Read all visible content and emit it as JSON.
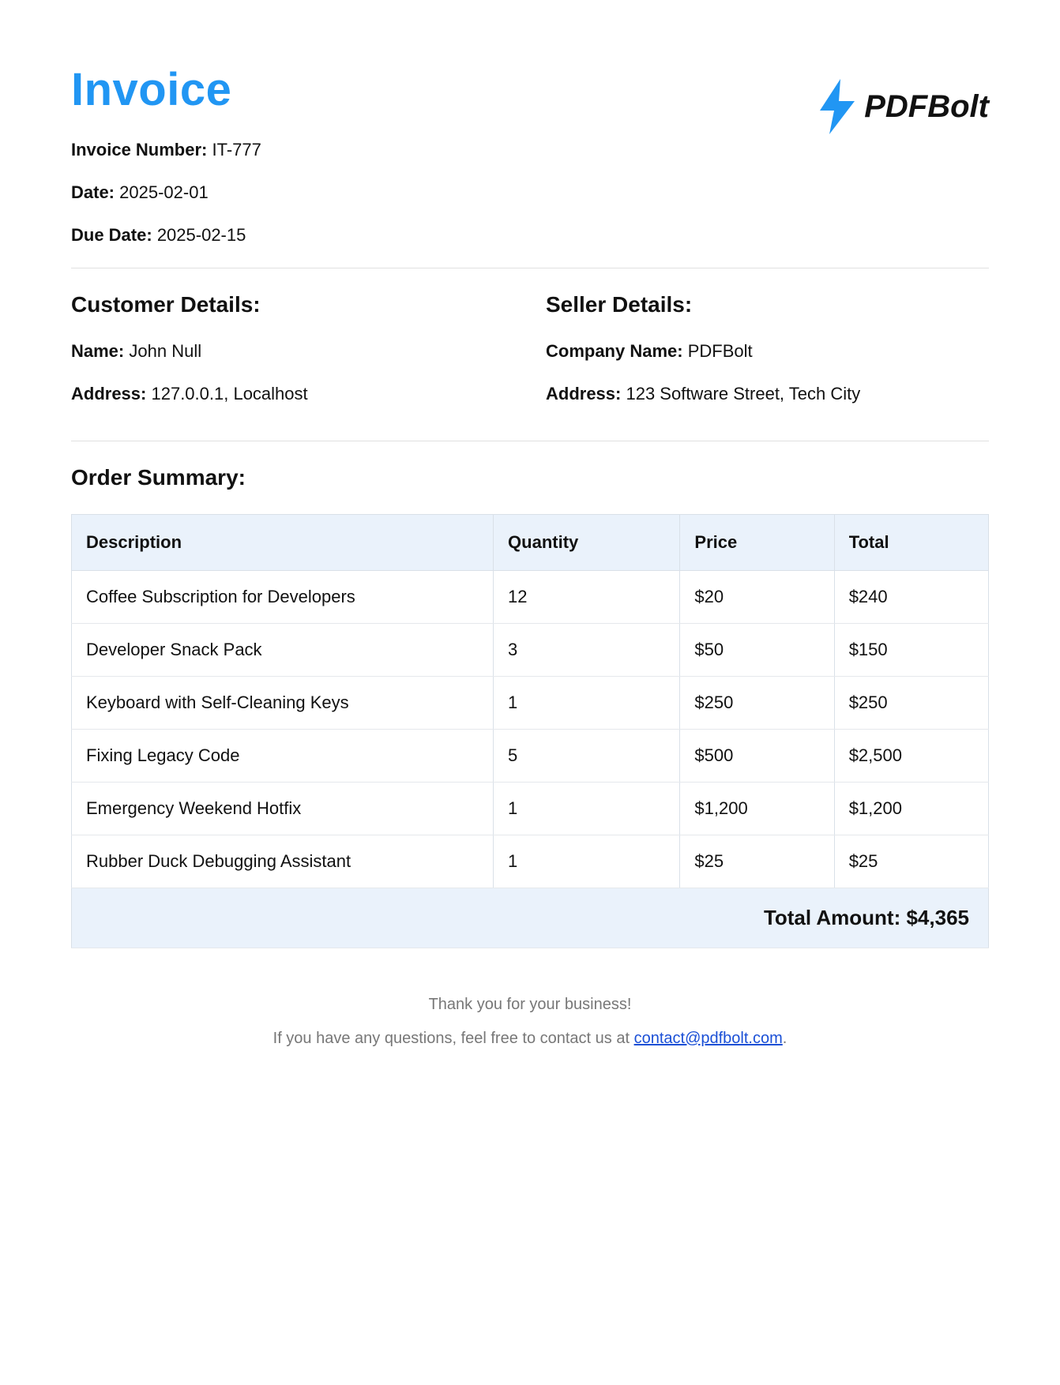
{
  "title": "Invoice",
  "logo_text": "PDFBolt",
  "meta": {
    "invoice_number_label": "Invoice Number:",
    "invoice_number": "IT-777",
    "date_label": "Date:",
    "date": "2025-02-01",
    "due_date_label": "Due Date:",
    "due_date": "2025-02-15"
  },
  "customer": {
    "heading": "Customer Details:",
    "name_label": "Name:",
    "name": "John Null",
    "address_label": "Address:",
    "address": "127.0.0.1, Localhost"
  },
  "seller": {
    "heading": "Seller Details:",
    "company_label": "Company Name:",
    "company": "PDFBolt",
    "address_label": "Address:",
    "address": "123 Software Street, Tech City"
  },
  "order": {
    "heading": "Order Summary:",
    "columns": {
      "description": "Description",
      "quantity": "Quantity",
      "price": "Price",
      "total": "Total"
    },
    "items": [
      {
        "description": "Coffee Subscription for Developers",
        "quantity": "12",
        "price": "$20",
        "total": "$240"
      },
      {
        "description": "Developer Snack Pack",
        "quantity": "3",
        "price": "$50",
        "total": "$150"
      },
      {
        "description": "Keyboard with Self-Cleaning Keys",
        "quantity": "1",
        "price": "$250",
        "total": "$250"
      },
      {
        "description": "Fixing Legacy Code",
        "quantity": "5",
        "price": "$500",
        "total": "$2,500"
      },
      {
        "description": "Emergency Weekend Hotfix",
        "quantity": "1",
        "price": "$1,200",
        "total": "$1,200"
      },
      {
        "description": "Rubber Duck Debugging Assistant",
        "quantity": "1",
        "price": "$25",
        "total": "$25"
      }
    ],
    "total_label": "Total Amount:",
    "total_value": "$4,365"
  },
  "footer": {
    "thanks": "Thank you for your business!",
    "contact_prefix": "If you have any questions, feel free to contact us at ",
    "contact_email": "contact@pdfbolt.com",
    "contact_suffix": "."
  }
}
